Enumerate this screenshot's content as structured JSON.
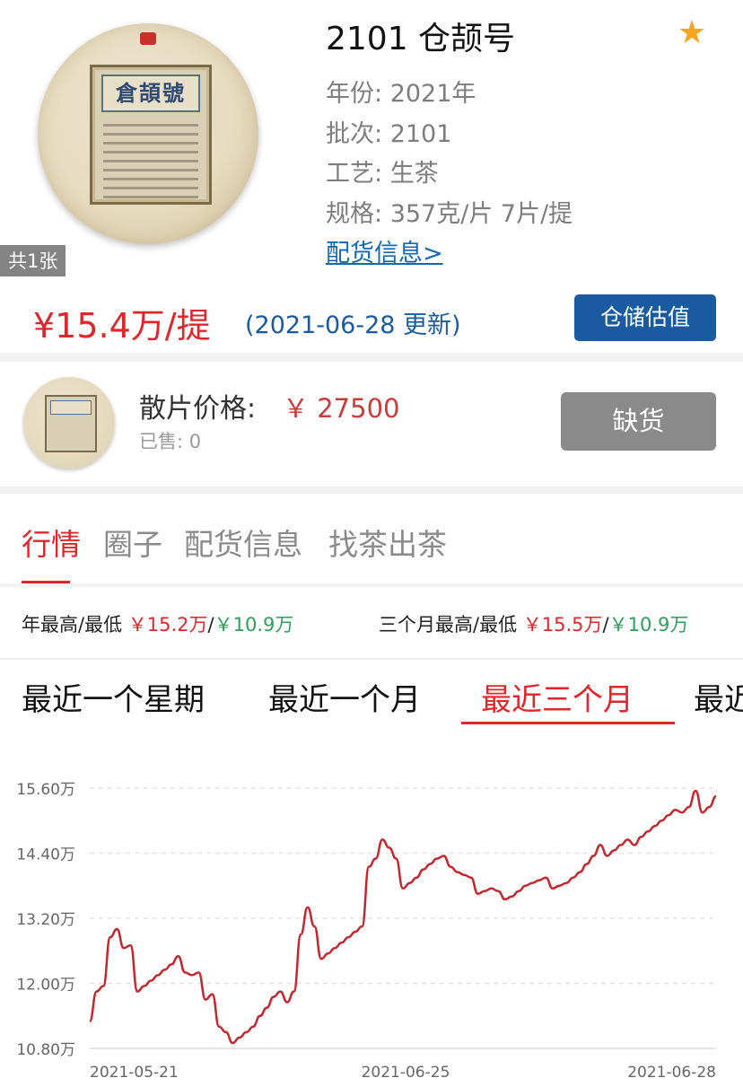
{
  "product": {
    "title": "2101 仓颉号",
    "photo_count": "共1张",
    "cake_label_text": "倉頡號",
    "favorite_icon": "star-icon",
    "attributes": {
      "year_label": "年份: ",
      "year_value": "2021年",
      "batch_label": "批次: ",
      "batch_value": "2101",
      "craft_label": "工艺: ",
      "craft_value": "生茶",
      "spec_label": "规格: ",
      "spec_value": "357克/片 7片/提"
    },
    "shipping_link": "配货信息>",
    "price": "¥15.4万/提",
    "price_update": "(2021-06-28 更新)",
    "valuation_button": "仓储估值",
    "colors": {
      "price_red": "#e0262a",
      "link_blue": "#1467b5",
      "button_blue": "#1a5aa0",
      "low_green": "#2f9e5a"
    }
  },
  "loose": {
    "label": "散片价格:",
    "price": "￥ 27500",
    "sold": "已售: 0",
    "button": "缺货"
  },
  "tabs": [
    {
      "label": "行情",
      "active": true
    },
    {
      "label": "圈子",
      "active": false
    },
    {
      "label": "配货信息",
      "active": false
    },
    {
      "label": "找茶出茶",
      "active": false
    }
  ],
  "stats": {
    "year_label": "年最高/最低",
    "year_high": "￥15.2万",
    "year_low": "￥10.9万",
    "quarter_label": "三个月最高/最低",
    "quarter_high": "￥15.5万",
    "quarter_low": "￥10.9万",
    "slash": "/"
  },
  "periods": [
    {
      "label": "最近一个星期",
      "active": false
    },
    {
      "label": "最近一个月",
      "active": false
    },
    {
      "label": "最近三个月",
      "active": true
    },
    {
      "label": "最近",
      "active": false
    }
  ],
  "chart_data": {
    "type": "line",
    "ylim": [
      10.8,
      15.6
    ],
    "y_ticks": [
      "15.60万",
      "14.40万",
      "13.20万",
      "12.00万",
      "10.80万"
    ],
    "y_tick_values": [
      15.6,
      14.4,
      13.2,
      12.0,
      10.8
    ],
    "x_ticks": [
      "2021-05-21",
      "2021-06-25",
      "2021-06-28"
    ],
    "grid": true,
    "line_color": "#c4262e",
    "values": [
      11.3,
      11.85,
      11.95,
      12.85,
      13.0,
      12.65,
      12.7,
      11.85,
      11.95,
      12.05,
      12.15,
      12.25,
      12.35,
      12.5,
      12.2,
      12.15,
      12.2,
      11.7,
      11.8,
      11.2,
      11.1,
      10.9,
      11.0,
      11.1,
      11.2,
      11.4,
      11.55,
      11.75,
      11.85,
      11.65,
      11.85,
      12.9,
      13.4,
      13.05,
      12.45,
      12.55,
      12.65,
      12.75,
      12.85,
      12.95,
      13.05,
      14.15,
      14.3,
      14.65,
      14.5,
      14.3,
      13.75,
      13.85,
      13.95,
      14.1,
      14.2,
      14.3,
      14.35,
      14.15,
      14.05,
      14.0,
      13.95,
      13.65,
      13.7,
      13.75,
      13.7,
      13.55,
      13.6,
      13.7,
      13.8,
      13.85,
      13.9,
      13.95,
      13.75,
      13.8,
      13.85,
      13.95,
      14.05,
      14.2,
      14.35,
      14.55,
      14.35,
      14.45,
      14.55,
      14.65,
      14.55,
      14.7,
      14.8,
      14.9,
      15.0,
      15.1,
      15.2,
      15.15,
      15.25,
      15.55,
      15.15,
      15.25,
      15.45
    ]
  }
}
